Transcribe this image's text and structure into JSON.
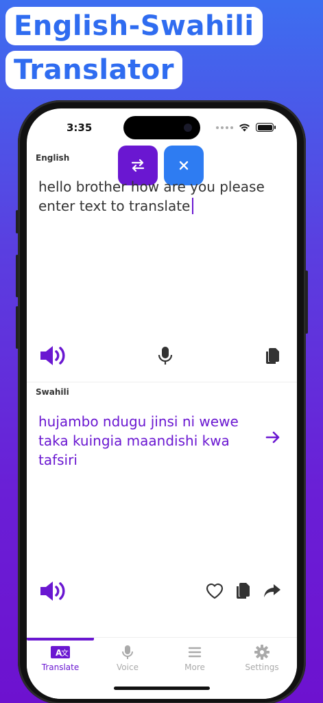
{
  "headline": {
    "line1": "English-Swahili",
    "line2": "Translator"
  },
  "status_bar": {
    "time": "3:35"
  },
  "source": {
    "language": "English",
    "text": "hello brother how are you please enter text to translate"
  },
  "target": {
    "language": "Swahili",
    "text": "hujambo ndugu jinsi ni wewe taka kuingia maandishi kwa tafsiri"
  },
  "tabs": [
    {
      "label": "Translate",
      "icon": "translate-icon",
      "active": true
    },
    {
      "label": "Voice",
      "icon": "microphone-icon",
      "active": false
    },
    {
      "label": "More",
      "icon": "menu-icon",
      "active": false
    },
    {
      "label": "Settings",
      "icon": "gear-icon",
      "active": false
    }
  ],
  "colors": {
    "accent_purple": "#6a17d1",
    "accent_blue": "#2e7cf2",
    "headline_blue": "#2f6cf0"
  }
}
